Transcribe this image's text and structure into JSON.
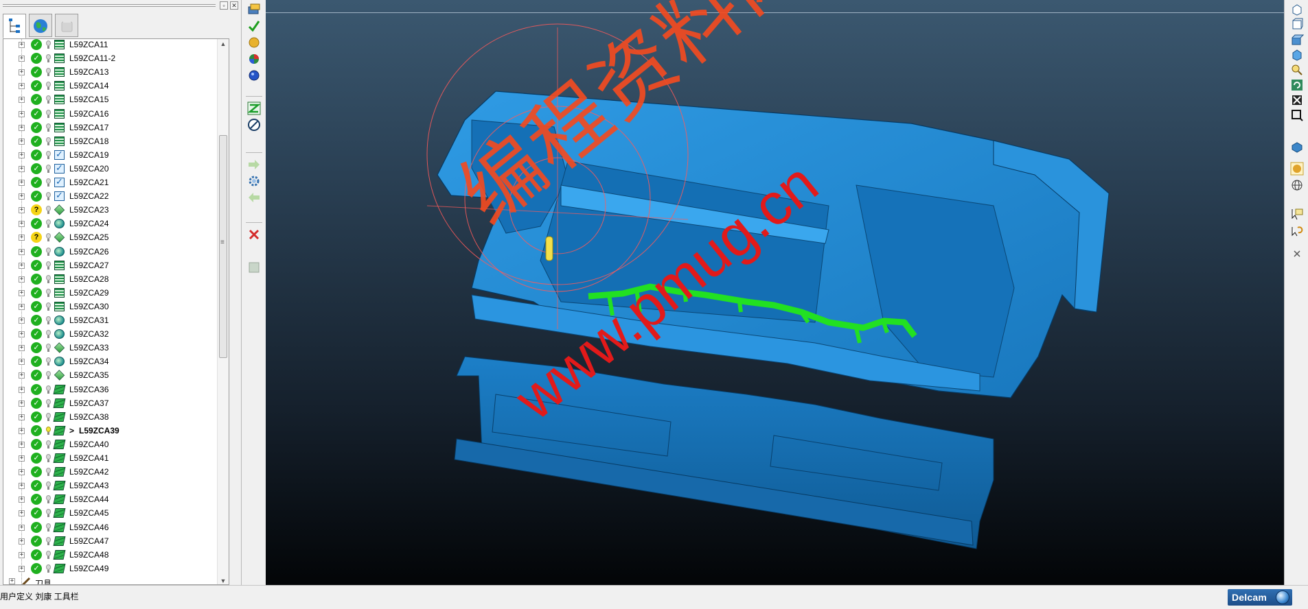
{
  "explorer": {
    "tabs": [
      {
        "icon": "tree-icon"
      },
      {
        "icon": "globe-icon"
      },
      {
        "icon": "folder-icon"
      }
    ],
    "toolpaths": [
      {
        "name": "L59ZCA11",
        "status": "check",
        "type": "lines"
      },
      {
        "name": "L59ZCA11-2",
        "status": "check",
        "type": "lines"
      },
      {
        "name": "L59ZCA13",
        "status": "check",
        "type": "lines"
      },
      {
        "name": "L59ZCA14",
        "status": "check",
        "type": "lines"
      },
      {
        "name": "L59ZCA15",
        "status": "check",
        "type": "lines"
      },
      {
        "name": "L59ZCA16",
        "status": "check",
        "type": "lines"
      },
      {
        "name": "L59ZCA17",
        "status": "check",
        "type": "lines"
      },
      {
        "name": "L59ZCA18",
        "status": "check",
        "type": "lines"
      },
      {
        "name": "L59ZCA19",
        "status": "check",
        "type": "check"
      },
      {
        "name": "L59ZCA20",
        "status": "check",
        "type": "check"
      },
      {
        "name": "L59ZCA21",
        "status": "check",
        "type": "check"
      },
      {
        "name": "L59ZCA22",
        "status": "check",
        "type": "check"
      },
      {
        "name": "L59ZCA23",
        "status": "question",
        "type": "cube"
      },
      {
        "name": "L59ZCA24",
        "status": "check",
        "type": "disc"
      },
      {
        "name": "L59ZCA25",
        "status": "question",
        "type": "cube"
      },
      {
        "name": "L59ZCA26",
        "status": "check",
        "type": "disc"
      },
      {
        "name": "L59ZCA27",
        "status": "check",
        "type": "lines"
      },
      {
        "name": "L59ZCA28",
        "status": "check",
        "type": "lines"
      },
      {
        "name": "L59ZCA29",
        "status": "check",
        "type": "lines"
      },
      {
        "name": "L59ZCA30",
        "status": "check",
        "type": "lines"
      },
      {
        "name": "L59ZCA31",
        "status": "check",
        "type": "disc"
      },
      {
        "name": "L59ZCA32",
        "status": "check",
        "type": "disc"
      },
      {
        "name": "L59ZCA33",
        "status": "check",
        "type": "cube"
      },
      {
        "name": "L59ZCA34",
        "status": "check",
        "type": "disc"
      },
      {
        "name": "L59ZCA35",
        "status": "check",
        "type": "cube"
      },
      {
        "name": "L59ZCA36",
        "status": "check",
        "type": "layers"
      },
      {
        "name": "L59ZCA37",
        "status": "check",
        "type": "layers"
      },
      {
        "name": "L59ZCA38",
        "status": "check",
        "type": "layers"
      },
      {
        "name": "L59ZCA39",
        "status": "check",
        "type": "layers",
        "prefix": ">",
        "active": true
      },
      {
        "name": "L59ZCA40",
        "status": "check",
        "type": "layers"
      },
      {
        "name": "L59ZCA41",
        "status": "check",
        "type": "layers"
      },
      {
        "name": "L59ZCA42",
        "status": "check",
        "type": "layers"
      },
      {
        "name": "L59ZCA43",
        "status": "check",
        "type": "layers"
      },
      {
        "name": "L59ZCA44",
        "status": "check",
        "type": "layers"
      },
      {
        "name": "L59ZCA45",
        "status": "check",
        "type": "layers"
      },
      {
        "name": "L59ZCA46",
        "status": "check",
        "type": "layers"
      },
      {
        "name": "L59ZCA47",
        "status": "check",
        "type": "layers"
      },
      {
        "name": "L59ZCA48",
        "status": "check",
        "type": "layers"
      },
      {
        "name": "L59ZCA49",
        "status": "check",
        "type": "layers"
      }
    ],
    "tools_node": "刀具"
  },
  "status_bar": {
    "text": "用户定义 刘康 工具栏",
    "logo": "Delcam"
  },
  "watermark": {
    "chinese": "编程资料网",
    "url": "www.pmug.cn"
  },
  "colors": {
    "model": "#1e8fd6",
    "toolpath": "#22e022",
    "watermark": "#f24b21"
  }
}
